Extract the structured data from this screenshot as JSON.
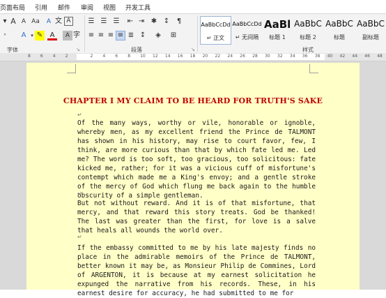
{
  "ribbon_tabs": [
    "页面布局",
    "引用",
    "邮件",
    "审阅",
    "视图",
    "开发工具"
  ],
  "groups": {
    "font": "字体",
    "paragraph": "段落",
    "styles": "样式"
  },
  "style_gallery": [
    {
      "sample": "AaBbCcDd",
      "name": "↵ 正文"
    },
    {
      "sample": "AaBbCcDd",
      "name": "↵ 无间隔"
    },
    {
      "sample": "AaBl",
      "name": "标题 1"
    },
    {
      "sample": "AaBbC",
      "name": "标题 2"
    },
    {
      "sample": "AaBbC",
      "name": "标题"
    },
    {
      "sample": "AaBbC",
      "name": "副标题"
    }
  ],
  "ruler_ticks": [
    "8",
    "6",
    "4",
    "2",
    "",
    "2",
    "4",
    "6",
    "8",
    "10",
    "12",
    "14",
    "16",
    "18",
    "20",
    "22",
    "24",
    "26",
    "28",
    "30",
    "32",
    "34",
    "36",
    "38",
    "40",
    "42",
    "44",
    "46",
    "48"
  ],
  "document": {
    "title": "CHAPTER I MY CLAIM TO BE HEARD FOR TRUTH'S SAKE",
    "paragraphs": [
      "Of the many ways, worthy or vile, honorable or ignoble, whereby men, as my excellent friend the Prince de TALMONT has shown in his history, may rise to court favor, few, I think, are more curious than that by which fate led me. Led me? The word is too soft, too gracious, too solicitous: fate kicked me, rather; for it was a vicious cuff of misfortune's contempt which made me a King's envoy; and a gentle stroke of the mercy of God which flung me back again to the humble obscurity of a simple gentleman.",
      "But not without reward. And it is of that misfortune, that mercy, and that reward this story treats. God be thanked! The last was greater than the first, for love is a salve that heals all wounds the world over.",
      "If the embassy committed to me by his late majesty finds no place in the admirable memoirs of the Prince de TALMONT, better known it may be, as Monsieur Philip de Commines, Lord of ARGENTON, it is because at my earnest solicitation he expunged the narrative from his records. These, in his earnest desire for accuracy, he had submitted to me for"
    ]
  },
  "colors": {
    "page": "#ffffc8",
    "title": "#c00000",
    "ribbon": "#f3f3f3"
  }
}
